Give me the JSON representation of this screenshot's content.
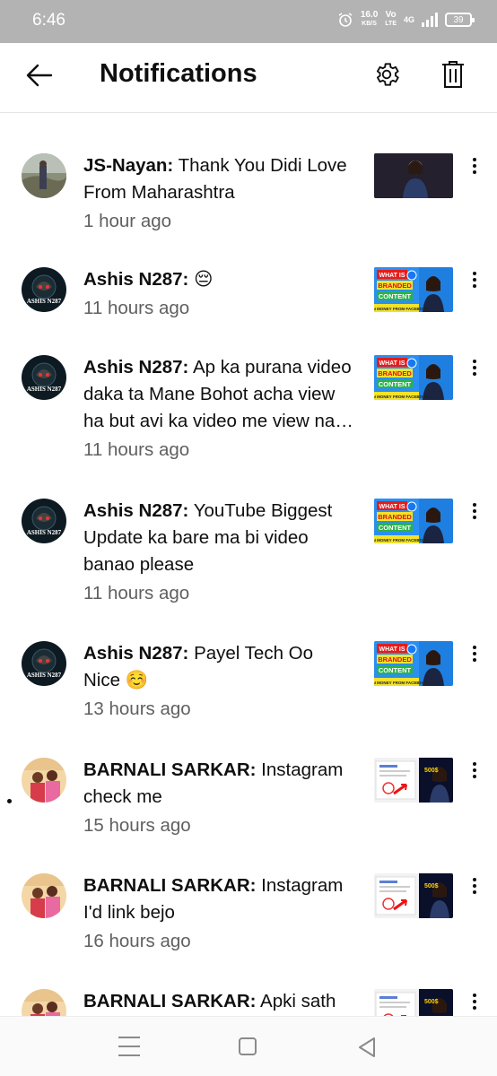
{
  "status": {
    "time": "6:46",
    "net_speed": "16.0",
    "net_unit": "KB/S",
    "volte_top": "Vo",
    "volte_bottom": "LTE",
    "network": "4G",
    "battery": "39"
  },
  "header": {
    "title": "Notifications",
    "back_icon": "arrow-left-icon",
    "settings_icon": "gear-icon",
    "delete_icon": "trash-icon"
  },
  "notifications": [
    {
      "author": "JS-Nayan:",
      "message_lines": [
        "Thank You Didi Love",
        "From Maharashtra"
      ],
      "time": "1 hour ago",
      "unread": false,
      "avatar": "landscape",
      "thumb": "dark-portrait"
    },
    {
      "author": "Ashis N287:",
      "message_lines": [
        "😔"
      ],
      "time": "11 hours ago",
      "unread": false,
      "avatar": "ashis",
      "thumb": "branded-content"
    },
    {
      "author": "Ashis N287:",
      "message_lines": [
        "Ap ka purana video",
        "daka ta Mane Bohot acha view",
        "ha but avi ka video me view na…"
      ],
      "time": "11 hours ago",
      "unread": false,
      "avatar": "ashis",
      "thumb": "branded-content"
    },
    {
      "author": "Ashis N287:",
      "message_lines": [
        "YouTube Biggest",
        "Update ka bare ma bi video",
        "banao please"
      ],
      "time": "11 hours ago",
      "unread": false,
      "avatar": "ashis",
      "thumb": "branded-content"
    },
    {
      "author": "Ashis N287:",
      "message_lines": [
        "Payel Tech Oo",
        "Nice ☺️"
      ],
      "time": "13 hours ago",
      "unread": false,
      "avatar": "ashis",
      "thumb": "branded-content"
    },
    {
      "author": "BARNALI SARKAR:",
      "message_lines": [
        "Instagram",
        "check me"
      ],
      "time": "15 hours ago",
      "unread": true,
      "avatar": "barnali",
      "thumb": "instagram"
    },
    {
      "author": "BARNALI SARKAR:",
      "message_lines": [
        "Instagram",
        "I'd link bejo"
      ],
      "time": "16 hours ago",
      "unread": false,
      "avatar": "barnali",
      "thumb": "instagram"
    },
    {
      "author": "BARNALI SARKAR:",
      "message_lines": [
        "Apki sath"
      ],
      "time": "",
      "unread": false,
      "avatar": "barnali",
      "thumb": "instagram"
    }
  ],
  "thumb_text": {
    "branded_line1": "WHAT IS",
    "branded_line2": "BRANDED",
    "branded_line3": "CONTENT",
    "branded_footer": "EARN MONEY FROM FACEBOOK",
    "instagram_badge": "500$"
  },
  "avatar_text": {
    "ashis": "ASHIS N287"
  },
  "nav": {
    "menu_icon": "recent-apps-icon",
    "home_icon": "home-square-icon",
    "back_icon": "back-triangle-icon"
  }
}
